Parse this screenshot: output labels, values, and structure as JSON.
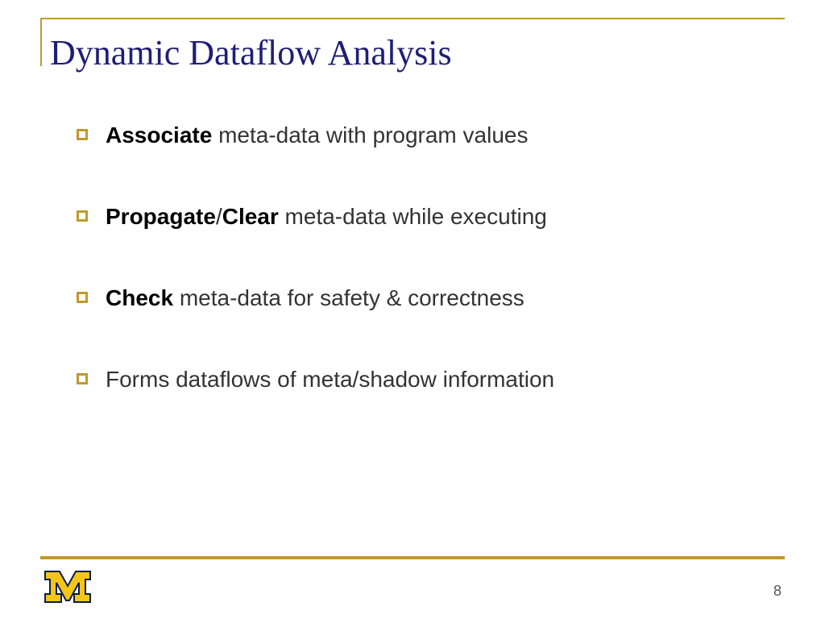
{
  "title": "Dynamic Dataflow Analysis",
  "bullets": [
    {
      "bold": "Associate",
      "rest": " meta-data with program values"
    },
    {
      "bold": "Propagate",
      "mid": "/",
      "bold2": "Clear",
      "rest": " meta-data while executing"
    },
    {
      "bold": "Check",
      "rest": " meta-data for safety & correctness"
    },
    {
      "bold": "",
      "rest": "Forms dataflows of meta/shadow information"
    }
  ],
  "page_number": "8",
  "colors": {
    "accent": "#c09a2a",
    "title": "#1e1e78"
  },
  "logo": {
    "name": "block-m",
    "fill": "#f5c518",
    "stroke": "#0a1f44"
  }
}
